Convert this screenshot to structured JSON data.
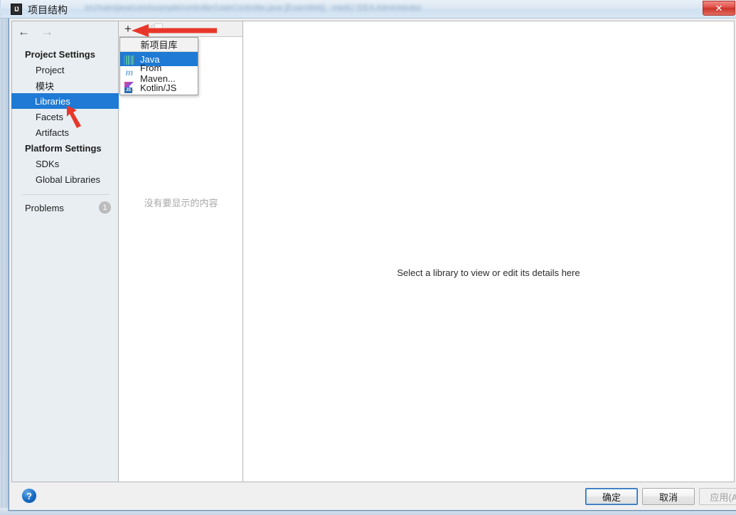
{
  "window": {
    "title": "项目结构",
    "logo_text": "IJ",
    "close_label": "✕",
    "ghost_title": "src/main/java/com/example/controller/UserController.java [ExamWeb] - IntelliJ IDEA Administrator"
  },
  "nav": {
    "back_icon": "←",
    "forward_icon": "→"
  },
  "sidebar": {
    "groups": [
      {
        "label": "Project Settings",
        "items": [
          {
            "label": "Project",
            "selected": false
          },
          {
            "label": "模块",
            "selected": false
          },
          {
            "label": "Libraries",
            "selected": true
          },
          {
            "label": "Facets",
            "selected": false
          },
          {
            "label": "Artifacts",
            "selected": false
          }
        ]
      },
      {
        "label": "Platform Settings",
        "items": [
          {
            "label": "SDKs",
            "selected": false
          },
          {
            "label": "Global Libraries",
            "selected": false
          }
        ]
      }
    ],
    "problems": {
      "label": "Problems",
      "count": "1"
    }
  },
  "middle": {
    "toolbar": {
      "add_label": "+",
      "copy_label": "copy"
    },
    "empty_message": "没有要显示的内容",
    "menu": {
      "header": "新项目库",
      "items": [
        {
          "label": "Java",
          "icon": "java-icon",
          "selected": true
        },
        {
          "label": "From Maven...",
          "icon": "maven-icon",
          "selected": false
        },
        {
          "label": "Kotlin/JS",
          "icon": "kotlin-js-icon",
          "selected": false
        }
      ]
    }
  },
  "detail": {
    "message": "Select a library to view or edit its details here"
  },
  "footer": {
    "help_label": "?",
    "ok_label": "确定",
    "cancel_label": "取消",
    "apply_label": "应用(A)"
  },
  "colors": {
    "selection_blue": "#1e7ad4",
    "annotation_red": "#e8372a",
    "close_red": "#cc342a",
    "help_blue": "#1769c0"
  }
}
